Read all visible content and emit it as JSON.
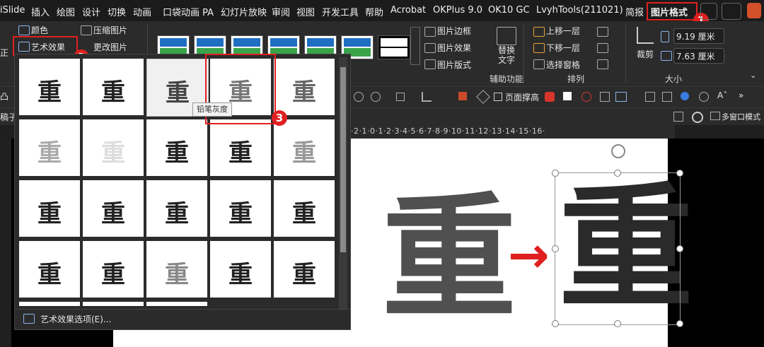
{
  "menu": {
    "tabs": [
      "iSlide",
      "插入",
      "绘图",
      "设计",
      "切换",
      "动画",
      "口袋动画 PA",
      "幻灯片放映",
      "审阅",
      "视图",
      "开发工具",
      "帮助",
      "Acrobat",
      "OKPlus 9.0",
      "OK10 GC",
      "LvyhTools(211021)",
      "简报",
      "图片格式"
    ],
    "active_tab": "图片格式"
  },
  "ribbon": {
    "color_label": "颜色",
    "art_effects_label": "艺术效果",
    "compress_label": "压缩图片",
    "change_label": "更改图片",
    "correction_partial": "正",
    "border_label": "图片边框",
    "effects_label": "图片效果",
    "layout_label": "图片版式",
    "alt_text_label": "替换\n文字",
    "accessibility_group": "辅助功能",
    "bring_forward": "上移一层",
    "send_backward": "下移一层",
    "selection_pane": "选择窗格",
    "arrange_group": "排列",
    "crop_label": "裁剪",
    "height_value": "9.19 厘米",
    "width_value": "7.63 厘米",
    "size_group": "大小"
  },
  "toolbar2": {
    "fill_page_label": "页面撑高"
  },
  "viewbar": {
    "left_label": "稿子",
    "multiwindow_label": "多窗口模式"
  },
  "ruler": {
    "text": "·2·1·0·1·2·3·4·5·6·7·8·9·10·11·12·13·14·15·16·"
  },
  "dropdown": {
    "cell_char": "重",
    "tooltip": "铅笔灰度",
    "options_label": "艺术效果选项(E)..."
  },
  "badges": [
    "1",
    "2",
    "3"
  ],
  "slide": {
    "left_char": "重",
    "right_char": "重",
    "arrow": "→"
  },
  "colors": {
    "accent_red": "#e02020",
    "ribbon_bg": "#2b2b2b",
    "menubar_bg": "#1b1b1b"
  }
}
